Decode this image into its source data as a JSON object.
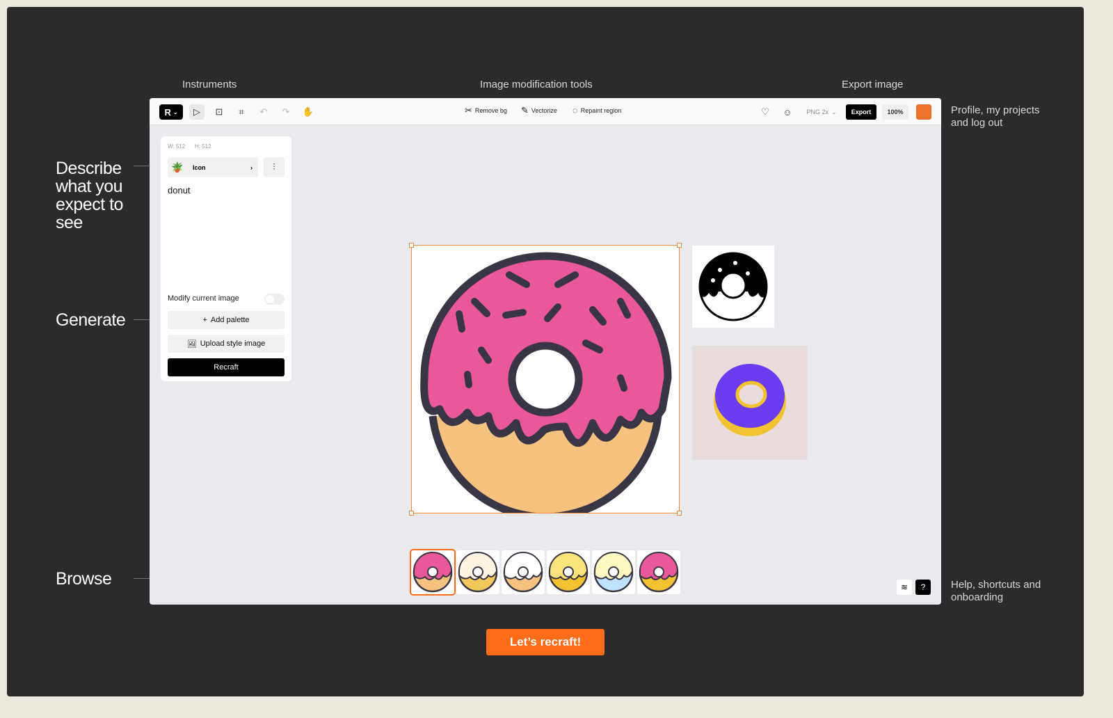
{
  "annotations": {
    "top": [
      "Instruments",
      "Image modification tools",
      "Export image"
    ],
    "left": {
      "describe": "Describe what you expect to see",
      "generate": "Generate",
      "browse": "Browse"
    },
    "right": {
      "profile": "Profile, my projects and log out",
      "help": "Help, shortcuts and onboarding"
    }
  },
  "toolbar": {
    "tools": [
      "logo-menu",
      "select",
      "add-frame",
      "crop",
      "undo",
      "redo",
      "hand"
    ],
    "modify": [
      {
        "label": "Remove bg",
        "icon": "scissors-icon"
      },
      {
        "label": "Vectorize",
        "icon": "vectorize-icon"
      },
      {
        "label": "Repaint region",
        "icon": "lasso-icon"
      }
    ],
    "format": "PNG 2x",
    "export_label": "Export",
    "zoom": "100%",
    "accent": "#ff6d1a"
  },
  "panel": {
    "width": "W: 512",
    "height": "H: 512",
    "style": "Icon",
    "prompt": "donut",
    "modify_label": "Modify current image",
    "modify_on": false,
    "add_palette": "Add palette",
    "upload_style": "Upload style image",
    "recraft": "Recraft"
  },
  "thumbnails_count": 6,
  "selected_thumbnail": 0,
  "cta": "Let’s recraft!"
}
